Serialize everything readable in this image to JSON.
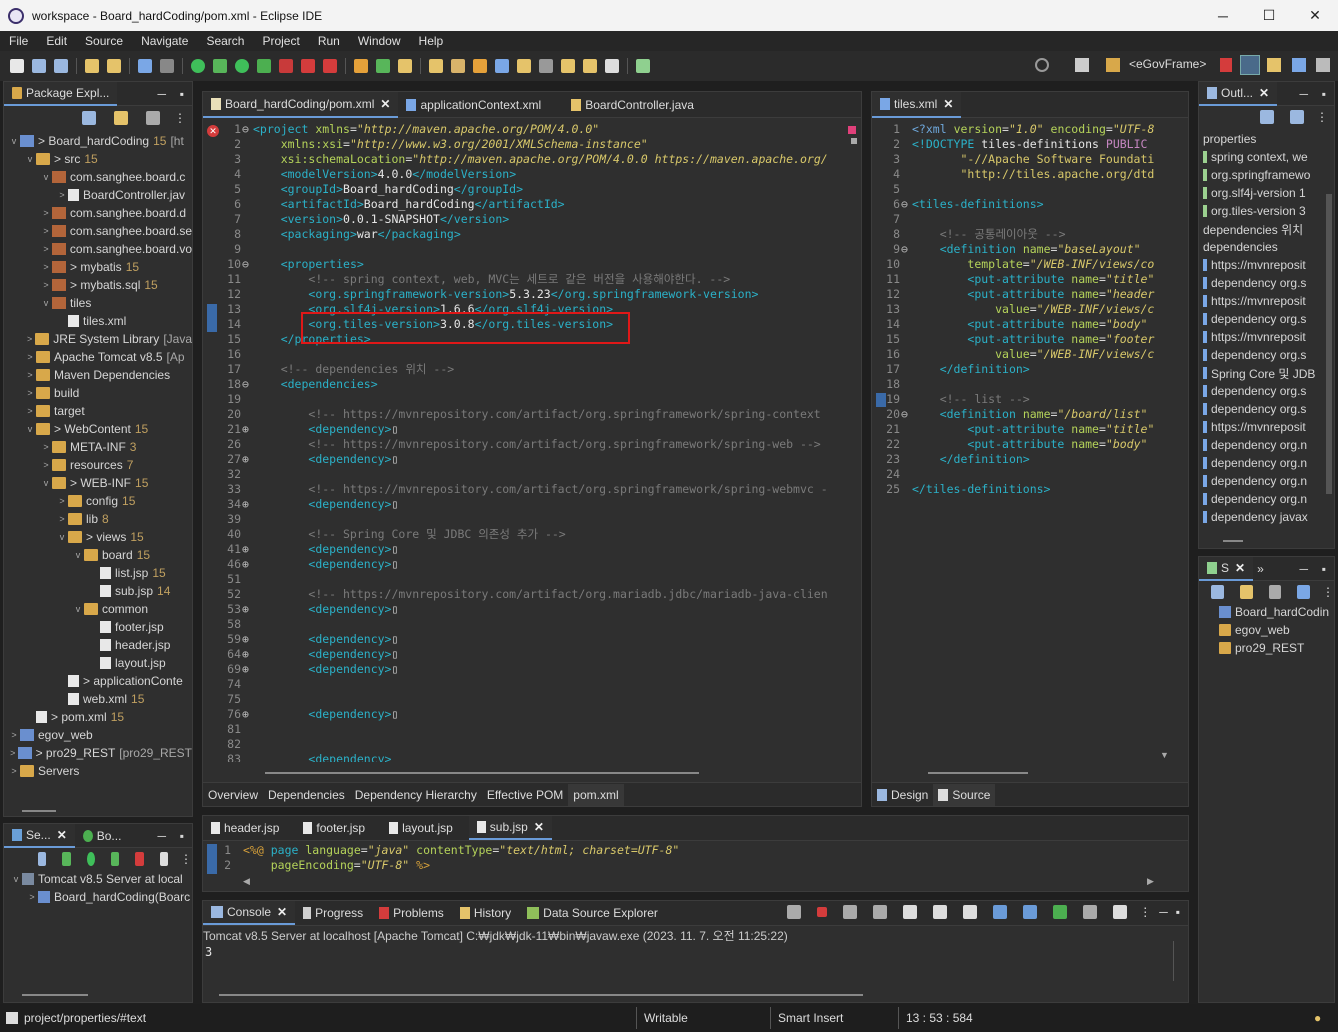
{
  "window": {
    "title": "workspace - Board_hardCoding/pom.xml - Eclipse IDE",
    "minimize": "─",
    "maximize": "☐",
    "close": "✕"
  },
  "menu": [
    "File",
    "Edit",
    "Source",
    "Navigate",
    "Search",
    "Project",
    "Run",
    "Window",
    "Help"
  ],
  "perspective": "<eGovFrame>",
  "pkg_explorer": {
    "tab": "Package Expl...",
    "tree": [
      {
        "d": 0,
        "tw": "v",
        "ic": "proj",
        "name": "> Board_hardCoding",
        "cnt": "15",
        "extra": "[ht"
      },
      {
        "d": 1,
        "tw": "v",
        "ic": "folder",
        "name": "> src",
        "cnt": "15"
      },
      {
        "d": 2,
        "tw": "v",
        "ic": "pkg",
        "name": "com.sanghee.board.c"
      },
      {
        "d": 3,
        "tw": ">",
        "ic": "file",
        "name": "BoardController.jav"
      },
      {
        "d": 2,
        "tw": ">",
        "ic": "pkg",
        "name": "com.sanghee.board.d"
      },
      {
        "d": 2,
        "tw": ">",
        "ic": "pkg",
        "name": "com.sanghee.board.se"
      },
      {
        "d": 2,
        "tw": ">",
        "ic": "pkg",
        "name": "com.sanghee.board.vo"
      },
      {
        "d": 2,
        "tw": ">",
        "ic": "pkg",
        "name": "> mybatis",
        "cnt": "15"
      },
      {
        "d": 2,
        "tw": ">",
        "ic": "pkg",
        "name": "> mybatis.sql",
        "cnt": "15"
      },
      {
        "d": 2,
        "tw": "v",
        "ic": "pkg",
        "name": "tiles"
      },
      {
        "d": 3,
        "tw": "",
        "ic": "file",
        "name": "tiles.xml"
      },
      {
        "d": 1,
        "tw": ">",
        "ic": "folder",
        "name": "JRE System Library",
        "extra": "[Java"
      },
      {
        "d": 1,
        "tw": ">",
        "ic": "folder",
        "name": "Apache Tomcat v8.5",
        "extra": "[Ap"
      },
      {
        "d": 1,
        "tw": ">",
        "ic": "folder",
        "name": "Maven Dependencies"
      },
      {
        "d": 1,
        "tw": ">",
        "ic": "folder",
        "name": "build"
      },
      {
        "d": 1,
        "tw": ">",
        "ic": "folder",
        "name": "target"
      },
      {
        "d": 1,
        "tw": "v",
        "ic": "folder",
        "name": "> WebContent",
        "cnt": "15"
      },
      {
        "d": 2,
        "tw": ">",
        "ic": "folder",
        "name": "META-INF",
        "cnt": "3"
      },
      {
        "d": 2,
        "tw": ">",
        "ic": "folder",
        "name": "resources",
        "cnt": "7"
      },
      {
        "d": 2,
        "tw": "v",
        "ic": "folder",
        "name": "> WEB-INF",
        "cnt": "15"
      },
      {
        "d": 3,
        "tw": ">",
        "ic": "folder",
        "name": "config",
        "cnt": "15"
      },
      {
        "d": 3,
        "tw": ">",
        "ic": "folder",
        "name": "lib",
        "cnt": "8"
      },
      {
        "d": 3,
        "tw": "v",
        "ic": "folder",
        "name": "> views",
        "cnt": "15"
      },
      {
        "d": 4,
        "tw": "v",
        "ic": "folder",
        "name": "board",
        "cnt": "15"
      },
      {
        "d": 5,
        "tw": "",
        "ic": "file",
        "name": "list.jsp",
        "cnt": "15"
      },
      {
        "d": 5,
        "tw": "",
        "ic": "file",
        "name": "sub.jsp",
        "cnt": "14"
      },
      {
        "d": 4,
        "tw": "v",
        "ic": "folder",
        "name": "common"
      },
      {
        "d": 5,
        "tw": "",
        "ic": "file",
        "name": "footer.jsp"
      },
      {
        "d": 5,
        "tw": "",
        "ic": "file",
        "name": "header.jsp"
      },
      {
        "d": 5,
        "tw": "",
        "ic": "file",
        "name": "layout.jsp"
      },
      {
        "d": 3,
        "tw": "",
        "ic": "file",
        "name": "> applicationConte"
      },
      {
        "d": 3,
        "tw": "",
        "ic": "file",
        "name": "web.xml",
        "cnt": "15"
      },
      {
        "d": 1,
        "tw": "",
        "ic": "file",
        "name": "> pom.xml",
        "cnt": "15"
      },
      {
        "d": 0,
        "tw": ">",
        "ic": "proj",
        "name": "egov_web"
      },
      {
        "d": 0,
        "tw": ">",
        "ic": "proj",
        "name": "> pro29_REST",
        "extra": "[pro29_REST"
      },
      {
        "d": 0,
        "tw": ">",
        "ic": "folder",
        "name": "Servers"
      }
    ]
  },
  "servers": {
    "tab1": "Se...",
    "tab2": "Bo...",
    "tree": [
      {
        "d": 0,
        "tw": "v",
        "name": "Tomcat v8.5 Server at local"
      },
      {
        "d": 1,
        "tw": ">",
        "name": "Board_hardCoding(Boarc"
      }
    ]
  },
  "editor": {
    "tabs": [
      {
        "label": "Board_hardCoding/pom.xml",
        "active": true
      },
      {
        "label": "applicationContext.xml"
      },
      {
        "label": "BoardController.java"
      }
    ],
    "bottom_tabs": [
      "Overview",
      "Dependencies",
      "Dependency Hierarchy",
      "Effective POM",
      "pom.xml"
    ],
    "lines": [
      {
        "n": "1",
        "f": "⊖",
        "h": "<span class='tag'>&lt;project</span> <span class='att'>xmlns</span>=<span class='val'>\"http://maven.apache.org/POM/4.0.0\"</span>"
      },
      {
        "n": "2",
        "h": "    <span class='att'>xmlns:xsi</span>=<span class='val'>\"http://www.w3.org/2001/XMLSchema-instance\"</span>"
      },
      {
        "n": "3",
        "h": "    <span class='att'>xsi:schemaLocation</span>=<span class='val'>\"http://maven.apache.org/POM/4.0.0 https://maven.apache.org/</span>"
      },
      {
        "n": "4",
        "h": "    <span class='tag'>&lt;modelVersion&gt;</span><span class='txt'>4.0.0</span><span class='tag'>&lt;/modelVersion&gt;</span>"
      },
      {
        "n": "5",
        "h": "    <span class='tag'>&lt;groupId&gt;</span><span class='txt'>Board_hardCoding</span><span class='tag'>&lt;/groupId&gt;</span>"
      },
      {
        "n": "6",
        "h": "    <span class='tag'>&lt;artifactId&gt;</span><span class='txt'>Board_hardCoding</span><span class='tag'>&lt;/artifactId&gt;</span>"
      },
      {
        "n": "7",
        "h": "    <span class='tag'>&lt;version&gt;</span><span class='txt'>0.0.1-SNAPSHOT</span><span class='tag'>&lt;/version&gt;</span>"
      },
      {
        "n": "8",
        "h": "    <span class='tag'>&lt;packaging&gt;</span><span class='txt'>war</span><span class='tag'>&lt;/packaging&gt;</span>"
      },
      {
        "n": "9",
        "h": ""
      },
      {
        "n": "10",
        "f": "⊖",
        "h": "    <span class='tag'>&lt;properties&gt;</span>"
      },
      {
        "n": "11",
        "h": "        <span class='cm'>&lt;!-- spring context, web, MVC는 세트로 같은 버전을 사용해야한다. --&gt;</span>"
      },
      {
        "n": "12",
        "h": "        <span class='tag'>&lt;org.springframework-version&gt;</span><span class='txt'>5.3.23</span><span class='tag'>&lt;/org.springframework-version&gt;</span>"
      },
      {
        "n": "13",
        "h": "        <span class='tag'>&lt;org.slf4j-version&gt;</span><span class='txt'>1.6.6</span><span class='tag'>&lt;/org.slf4j-version&gt;</span>"
      },
      {
        "n": "14",
        "h": "        <span class='tag'>&lt;org.tiles-version&gt;</span><span class='txt'>3.0.8</span><span class='tag'>&lt;/org.tiles-version&gt;</span>"
      },
      {
        "n": "15",
        "h": "    <span class='tag'>&lt;/properties&gt;</span>"
      },
      {
        "n": "16",
        "h": ""
      },
      {
        "n": "17",
        "h": "    <span class='cm'>&lt;!-- dependencies 위치 --&gt;</span>"
      },
      {
        "n": "18",
        "f": "⊖",
        "h": "    <span class='tag'>&lt;dependencies&gt;</span>"
      },
      {
        "n": "19",
        "h": ""
      },
      {
        "n": "20",
        "h": "        <span class='cm'>&lt;!-- https://mvnrepository.com/artifact/org.springframework/spring-context</span>"
      },
      {
        "n": "21",
        "f": "⊕",
        "h": "        <span class='tag'>&lt;dependency&gt;</span>▯"
      },
      {
        "n": "26",
        "h": "        <span class='cm'>&lt;!-- https://mvnrepository.com/artifact/org.springframework/spring-web --&gt;</span>"
      },
      {
        "n": "27",
        "f": "⊕",
        "h": "        <span class='tag'>&lt;dependency&gt;</span>▯"
      },
      {
        "n": "32",
        "h": ""
      },
      {
        "n": "33",
        "h": "        <span class='cm'>&lt;!-- https://mvnrepository.com/artifact/org.springframework/spring-webmvc -</span>"
      },
      {
        "n": "34",
        "f": "⊕",
        "h": "        <span class='tag'>&lt;dependency&gt;</span>▯"
      },
      {
        "n": "39",
        "h": ""
      },
      {
        "n": "40",
        "h": "        <span class='cm'>&lt;!-- Spring Core 및 JDBC 의존성 추가 --&gt;</span>"
      },
      {
        "n": "41",
        "f": "⊕",
        "h": "        <span class='tag'>&lt;dependency&gt;</span>▯"
      },
      {
        "n": "46",
        "f": "⊕",
        "h": "        <span class='tag'>&lt;dependency&gt;</span>▯"
      },
      {
        "n": "51",
        "h": ""
      },
      {
        "n": "52",
        "h": "        <span class='cm'>&lt;!-- https://mvnrepository.com/artifact/org.mariadb.jdbc/mariadb-java-clien</span>"
      },
      {
        "n": "53",
        "f": "⊕",
        "h": "        <span class='tag'>&lt;dependency&gt;</span>▯"
      },
      {
        "n": "58",
        "h": ""
      },
      {
        "n": "59",
        "f": "⊕",
        "h": "        <span class='tag'>&lt;dependency&gt;</span>▯"
      },
      {
        "n": "64",
        "f": "⊕",
        "h": "        <span class='tag'>&lt;dependency&gt;</span>▯"
      },
      {
        "n": "69",
        "f": "⊕",
        "h": "        <span class='tag'>&lt;dependency&gt;</span>▯"
      },
      {
        "n": "74",
        "h": ""
      },
      {
        "n": "75",
        "h": ""
      },
      {
        "n": "76",
        "f": "⊕",
        "h": "        <span class='tag'>&lt;dependency&gt;</span>▯"
      },
      {
        "n": "81",
        "h": ""
      },
      {
        "n": "82",
        "h": ""
      },
      {
        "n": "83",
        "h": "        <span class='tag'>&lt;dependency&gt;</span>"
      }
    ]
  },
  "tiles": {
    "tab": "tiles.xml",
    "bottom_tabs": [
      "Design",
      "Source"
    ],
    "lines": [
      {
        "n": "1",
        "h": "<span class='pi'>&lt;?xml</span> <span class='att'>version</span>=<span class='val'>\"1.0\"</span> <span class='att'>encoding</span>=<span class='val'>\"UTF-8</span>"
      },
      {
        "n": "2",
        "h": "<span class='tag'>&lt;!DOCTYPE</span> <span class='txt'>tiles-definitions</span> <span class='kw'>PUBLIC</span>"
      },
      {
        "n": "3",
        "h": "       <span class='val' style='font-style:normal'>\"-//Apache Software Foundati</span>"
      },
      {
        "n": "4",
        "h": "       <span class='val' style='font-style:normal'>\"http://tiles.apache.org/dtd</span>"
      },
      {
        "n": "5",
        "h": ""
      },
      {
        "n": "6",
        "f": "⊖",
        "h": "<span class='tag'>&lt;tiles-definitions&gt;</span>"
      },
      {
        "n": "7",
        "h": ""
      },
      {
        "n": "8",
        "h": "    <span class='cm'>&lt;!-- 공통레이아웃 --&gt;</span>"
      },
      {
        "n": "9",
        "f": "⊖",
        "h": "    <span class='tag'>&lt;definition</span> <span class='att'>name</span>=<span class='val'>\"baseLayout\"</span>"
      },
      {
        "n": "10",
        "h": "        <span class='att'>template</span>=<span class='val'>\"/WEB-INF/views/co</span>"
      },
      {
        "n": "11",
        "h": "        <span class='tag'>&lt;put-attribute</span> <span class='att'>name</span>=<span class='val'>\"title\"</span>"
      },
      {
        "n": "12",
        "h": "        <span class='tag'>&lt;put-attribute</span> <span class='att'>name</span>=<span class='val'>\"header</span>"
      },
      {
        "n": "13",
        "h": "            <span class='att'>value</span>=<span class='val'>\"/WEB-INF/views/c</span>"
      },
      {
        "n": "14",
        "h": "        <span class='tag'>&lt;put-attribute</span> <span class='att'>name</span>=<span class='val'>\"body\"</span>"
      },
      {
        "n": "15",
        "h": "        <span class='tag'>&lt;put-attribute</span> <span class='att'>name</span>=<span class='val'>\"footer</span>"
      },
      {
        "n": "16",
        "h": "            <span class='att'>value</span>=<span class='val'>\"/WEB-INF/views/c</span>"
      },
      {
        "n": "17",
        "h": "    <span class='tag'>&lt;/definition&gt;</span>"
      },
      {
        "n": "18",
        "h": ""
      },
      {
        "n": "19",
        "h": "    <span class='cm'>&lt;!-- list --&gt;</span>"
      },
      {
        "n": "20",
        "f": "⊖",
        "h": "    <span class='tag'>&lt;definition</span> <span class='att'>name</span>=<span class='val'>\"/board/list\"</span>"
      },
      {
        "n": "21",
        "h": "        <span class='tag'>&lt;put-attribute</span> <span class='att'>name</span>=<span class='val'>\"title\"</span>"
      },
      {
        "n": "22",
        "h": "        <span class='tag'>&lt;put-attribute</span> <span class='att'>name</span>=<span class='val'>\"body\"</span>"
      },
      {
        "n": "23",
        "h": "    <span class='tag'>&lt;/definition&gt;</span>"
      },
      {
        "n": "24",
        "h": ""
      },
      {
        "n": "25",
        "h": "<span class='tag'>&lt;/tiles-definitions&gt;</span>"
      }
    ]
  },
  "outline": {
    "tab": "Outl...",
    "items": [
      "properties",
      "spring context, we",
      "org.springframewo",
      "org.slf4j-version  1",
      "org.tiles-version  3",
      "dependencies 위치",
      "dependencies",
      "https://mvnreposit",
      "dependency  org.s",
      "https://mvnreposit",
      "dependency  org.s",
      "https://mvnreposit",
      "dependency  org.s",
      "Spring Core 및 JDB",
      "dependency  org.s",
      "dependency  org.s",
      "https://mvnreposit",
      "dependency  org.n",
      "dependency  org.n",
      "dependency  org.n",
      "dependency  org.n",
      "dependency  javax"
    ]
  },
  "mini": {
    "tab": "S",
    "items": [
      "Board_hardCodin",
      "egov_web",
      "pro29_REST"
    ]
  },
  "jsp": {
    "tabs": [
      {
        "label": "header.jsp"
      },
      {
        "label": "footer.jsp"
      },
      {
        "label": "layout.jsp"
      },
      {
        "label": "sub.jsp",
        "active": true
      }
    ],
    "lines": [
      {
        "n": "1",
        "h": "<span class='jsp'>&lt;%@</span> <span class='tag'>page</span> <span class='att'>language</span>=<span class='val'>\"java\"</span> <span class='att'>contentType</span>=<span class='val'>\"text/html; charset=UTF-8\"</span>"
      },
      {
        "n": "2",
        "h": "    <span class='att'>pageEncoding</span>=<span class='val'>\"UTF-8\"</span> <span class='jsp'>%&gt;</span>"
      }
    ]
  },
  "console": {
    "tabs": [
      "Console",
      "Progress",
      "Problems",
      "History",
      "Data Source Explorer"
    ],
    "header": "Tomcat v8.5 Server at localhost [Apache Tomcat] C:₩jdk₩jdk-11₩bin₩javaw.exe  (2023. 11. 7. 오전 11:25:22)",
    "output": "3"
  },
  "status": {
    "path": "project/properties/#text",
    "mode": "Writable",
    "insert": "Smart Insert",
    "pos": "13 : 53 : 584"
  },
  "colors": {
    "highlight": "#e01818",
    "accent": "#6a9bd8"
  }
}
